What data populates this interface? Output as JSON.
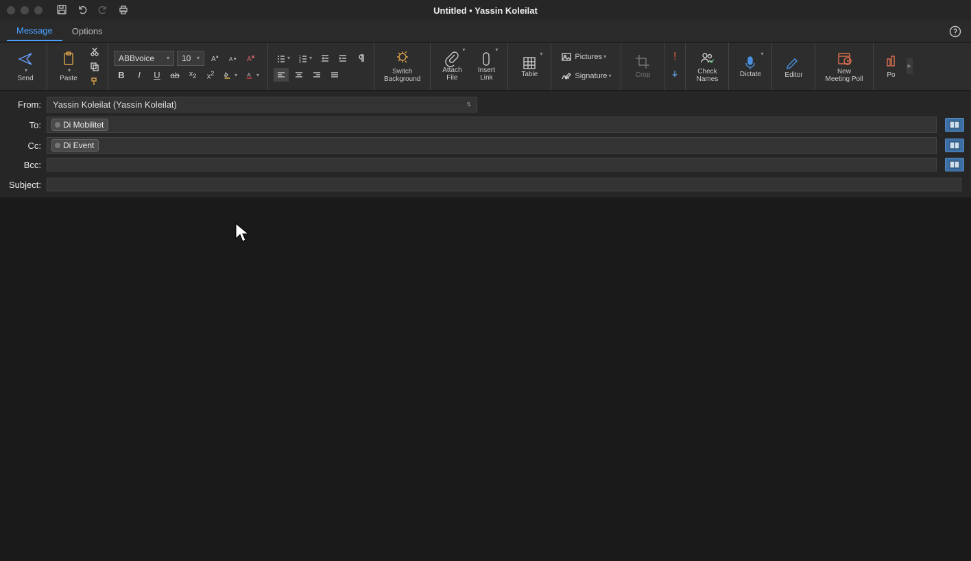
{
  "window": {
    "title": "Untitled • Yassin Koleilat"
  },
  "tabs": {
    "message": "Message",
    "options": "Options"
  },
  "ribbon": {
    "send": "Send",
    "paste": "Paste",
    "font_name": "ABBvoice",
    "font_size": "10",
    "switch_bg": "Switch\nBackground",
    "attach_file": "Attach\nFile",
    "insert_link": "Insert\nLink",
    "table": "Table",
    "pictures": "Pictures",
    "signature": "Signature",
    "crop": "Crop",
    "check_names": "Check\nNames",
    "dictate": "Dictate",
    "editor": "Editor",
    "meeting_poll": "New\nMeeting Poll",
    "po": "Po"
  },
  "fields": {
    "from_label": "From:",
    "from_value": "Yassin Koleilat (Yassin Koleilat)",
    "to_label": "To:",
    "to_chip": "Di Mobilitet",
    "cc_label": "Cc:",
    "cc_chip": "Di Event",
    "bcc_label": "Bcc:",
    "subject_label": "Subject:"
  }
}
